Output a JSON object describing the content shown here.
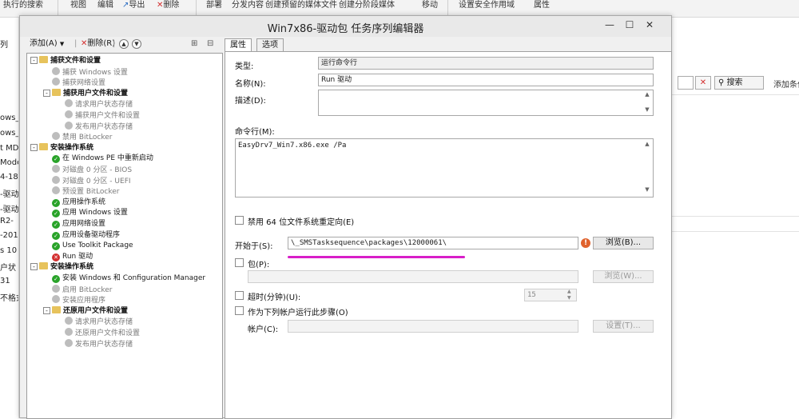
{
  "bg_app": {
    "ribbon": [
      "执行的搜索",
      "视图",
      "编辑",
      "导出",
      "删除",
      "部署",
      "分发内容",
      "创建预留的媒体文件",
      "创建分阶段媒体",
      "移动",
      "设置安全作用域",
      "属性"
    ],
    "left_items": [
      "列",
      "ows_",
      "ows_",
      "t MD",
      "Mode",
      "4-18",
      "-驱动",
      "-驱动",
      "R2-",
      "-201",
      "s 10",
      "户状",
      "31",
      "不格式"
    ],
    "search_label": "搜索",
    "add_condition": "添加条件"
  },
  "dialog": {
    "title": "Win7x86-驱动包 任务序列编辑器",
    "toolbar": {
      "add": "添加(A)",
      "remove": "删除(R)"
    },
    "tabs": [
      "属性",
      "选项"
    ],
    "tree": [
      {
        "label": "捕获文件和设置",
        "level": 0,
        "icon": "folder",
        "bold": true,
        "expand": "-"
      },
      {
        "label": "捕获 Windows 设置",
        "level": 1,
        "icon": "grey",
        "grey": true
      },
      {
        "label": "捕获网络设置",
        "level": 1,
        "icon": "grey",
        "grey": true
      },
      {
        "label": "捕获用户文件和设置",
        "level": 1,
        "icon": "folder",
        "bold": true,
        "expand": "-"
      },
      {
        "label": "请求用户状态存储",
        "level": 2,
        "icon": "grey",
        "grey": true
      },
      {
        "label": "捕获用户文件和设置",
        "level": 2,
        "icon": "grey",
        "grey": true
      },
      {
        "label": "发布用户状态存储",
        "level": 2,
        "icon": "grey",
        "grey": true
      },
      {
        "label": "禁用 BitLocker",
        "level": 1,
        "icon": "grey",
        "grey": true
      },
      {
        "label": "安装操作系统",
        "level": 0,
        "icon": "folder",
        "bold": true,
        "expand": "-"
      },
      {
        "label": "在 Windows PE 中重新启动",
        "level": 1,
        "icon": "green"
      },
      {
        "label": "对磁盘 0 分区 - BIOS",
        "level": 1,
        "icon": "grey",
        "grey": true
      },
      {
        "label": "对磁盘 0 分区 - UEFI",
        "level": 1,
        "icon": "grey",
        "grey": true
      },
      {
        "label": "预设置 BitLocker",
        "level": 1,
        "icon": "grey",
        "grey": true
      },
      {
        "label": "应用操作系统",
        "level": 1,
        "icon": "green"
      },
      {
        "label": "应用 Windows 设置",
        "level": 1,
        "icon": "green"
      },
      {
        "label": "应用网络设置",
        "level": 1,
        "icon": "green"
      },
      {
        "label": "应用设备驱动程序",
        "level": 1,
        "icon": "green"
      },
      {
        "label": "Use Toolkit Package",
        "level": 1,
        "icon": "green"
      },
      {
        "label": "Run 驱动",
        "level": 1,
        "icon": "red"
      },
      {
        "label": "安装操作系统",
        "level": 0,
        "icon": "folder",
        "bold": true,
        "expand": "-"
      },
      {
        "label": "安装 Windows 和 Configuration Manager",
        "level": 1,
        "icon": "green"
      },
      {
        "label": "启用 BitLocker",
        "level": 1,
        "icon": "grey",
        "grey": true
      },
      {
        "label": "安装应用程序",
        "level": 1,
        "icon": "grey",
        "grey": true
      },
      {
        "label": "还原用户文件和设置",
        "level": 1,
        "icon": "folder",
        "bold": true,
        "expand": "-"
      },
      {
        "label": "请求用户状态存储",
        "level": 2,
        "icon": "grey",
        "grey": true
      },
      {
        "label": "还原用户文件和设置",
        "level": 2,
        "icon": "grey",
        "grey": true
      },
      {
        "label": "发布用户状态存储",
        "level": 2,
        "icon": "grey",
        "grey": true
      }
    ],
    "props": {
      "type_label": "类型:",
      "type_value": "运行命令行",
      "name_label": "名称(N):",
      "name_value": "Run 驱动",
      "desc_label": "描述(D):",
      "desc_value": "",
      "cmd_label": "命令行(M):",
      "cmd_value": "EasyDrv7_Win7.x86.exe /Pa",
      "disable64_label": "禁用 64 位文件系统重定向(E)",
      "startin_label": "开始于(S):",
      "startin_value": "\\_SMSTasksequence\\packages\\12000061\\",
      "browse_label": "浏览(B)...",
      "package_label": "包(P):",
      "package_value": "",
      "browse2_label": "浏览(W)...",
      "timeout_label": "超时(分钟)(U):",
      "timeout_value": "15",
      "runas_label": "作为下列帐户运行此步骤(O)",
      "account_label": "帐户(C):",
      "account_value": "",
      "set_label": "设置(T)..."
    },
    "highlight_color": "#d81ec8"
  }
}
